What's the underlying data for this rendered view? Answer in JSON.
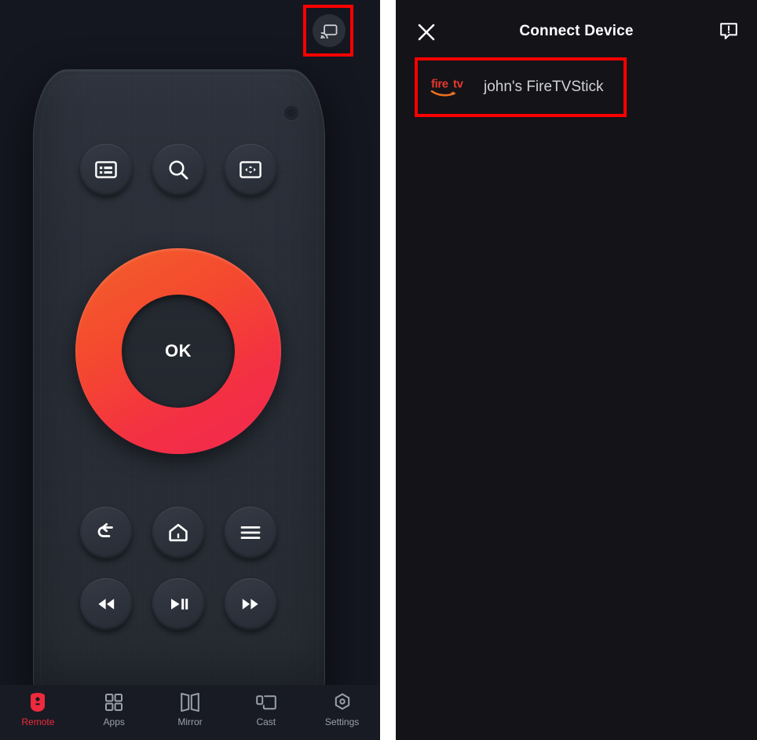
{
  "app": {
    "accent_red": "#ee2a3c",
    "highlight_box_color": "#fe0000",
    "left_bg": "#141620",
    "right_bg": "#141318",
    "remote_body_color": "#2a2f38",
    "ok_gradient_from": "#f2612a",
    "ok_gradient_to": "#f2294f"
  },
  "remote_screen": {
    "cast_button": {
      "icon": "cast-icon",
      "label": "Cast"
    },
    "ok_button": {
      "label": "OK",
      "icon": "dpad-ring"
    },
    "led_indicator": {
      "icon": "led-dot-icon"
    },
    "keys": [
      {
        "id": "keyboard",
        "icon": "keyboard-icon",
        "label": "Keyboard"
      },
      {
        "id": "search",
        "icon": "search-icon",
        "label": "Search"
      },
      {
        "id": "navpad",
        "icon": "navigation-pad-icon",
        "label": "Navigation"
      },
      {
        "id": "back",
        "icon": "back-arrow-icon",
        "label": "Back"
      },
      {
        "id": "home",
        "icon": "home-icon",
        "label": "Home"
      },
      {
        "id": "menu",
        "icon": "menu-icon",
        "label": "Menu"
      },
      {
        "id": "rewind",
        "icon": "rewind-icon",
        "label": "Rewind"
      },
      {
        "id": "playpause",
        "icon": "play-pause-icon",
        "label": "Play / Pause"
      },
      {
        "id": "forward",
        "icon": "fast-forward-icon",
        "label": "Fast Forward"
      }
    ]
  },
  "tabbar": {
    "items": [
      {
        "label": "Remote",
        "icon": "remote-icon",
        "active": true
      },
      {
        "label": "Apps",
        "icon": "apps-grid-icon",
        "active": false
      },
      {
        "label": "Mirror",
        "icon": "mirror-icon",
        "active": false
      },
      {
        "label": "Cast",
        "icon": "cast-screen-icon",
        "active": false
      },
      {
        "label": "Settings",
        "icon": "settings-hex-icon",
        "active": false
      }
    ]
  },
  "connect_device": {
    "title": "Connect Device",
    "close_icon": "close-icon",
    "help_icon": "feedback-icon",
    "devices": [
      {
        "name": "john's FireTVStick",
        "brand_logo": "fire-tv-logo",
        "brand_text_1": "fire",
        "brand_text_2": "tv"
      }
    ]
  }
}
